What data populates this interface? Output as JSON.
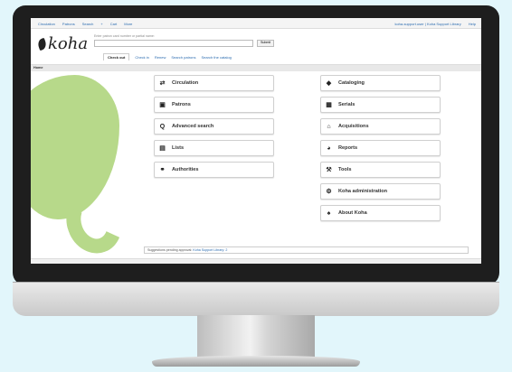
{
  "topnav": {
    "left": [
      "Circulation",
      "Patrons",
      "Search",
      "+",
      "Cart",
      "More"
    ],
    "right": [
      "koha-support.user | Koha Support Library",
      "Help"
    ]
  },
  "logo": "koha",
  "search": {
    "hint": "Enter patron card number or partial name:",
    "placeholder": "",
    "submit": "Submit",
    "tabs": [
      "Check out",
      "Check in",
      "Renew",
      "Search patrons",
      "Search the catalog"
    ]
  },
  "breadcrumb": "Home",
  "modules_left": [
    {
      "label": "Circulation",
      "icon": "circulation-icon"
    },
    {
      "label": "Patrons",
      "icon": "patrons-icon"
    },
    {
      "label": "Advanced search",
      "icon": "search-icon"
    },
    {
      "label": "Lists",
      "icon": "lists-icon"
    },
    {
      "label": "Authorities",
      "icon": "authorities-icon"
    }
  ],
  "modules_right": [
    {
      "label": "Cataloging",
      "icon": "cataloging-icon"
    },
    {
      "label": "Serials",
      "icon": "serials-icon"
    },
    {
      "label": "Acquisitions",
      "icon": "acquisitions-icon"
    },
    {
      "label": "Reports",
      "icon": "reports-icon"
    },
    {
      "label": "Tools",
      "icon": "tools-icon"
    },
    {
      "label": "Koha administration",
      "icon": "administration-icon"
    },
    {
      "label": "About Koha",
      "icon": "about-icon"
    }
  ],
  "news": {
    "prefix": "Suggestions pending approval:",
    "link": "Koha Support Library: 2"
  },
  "colors": {
    "accent": "#2c6cb0",
    "leaf": "#b7d98a"
  }
}
